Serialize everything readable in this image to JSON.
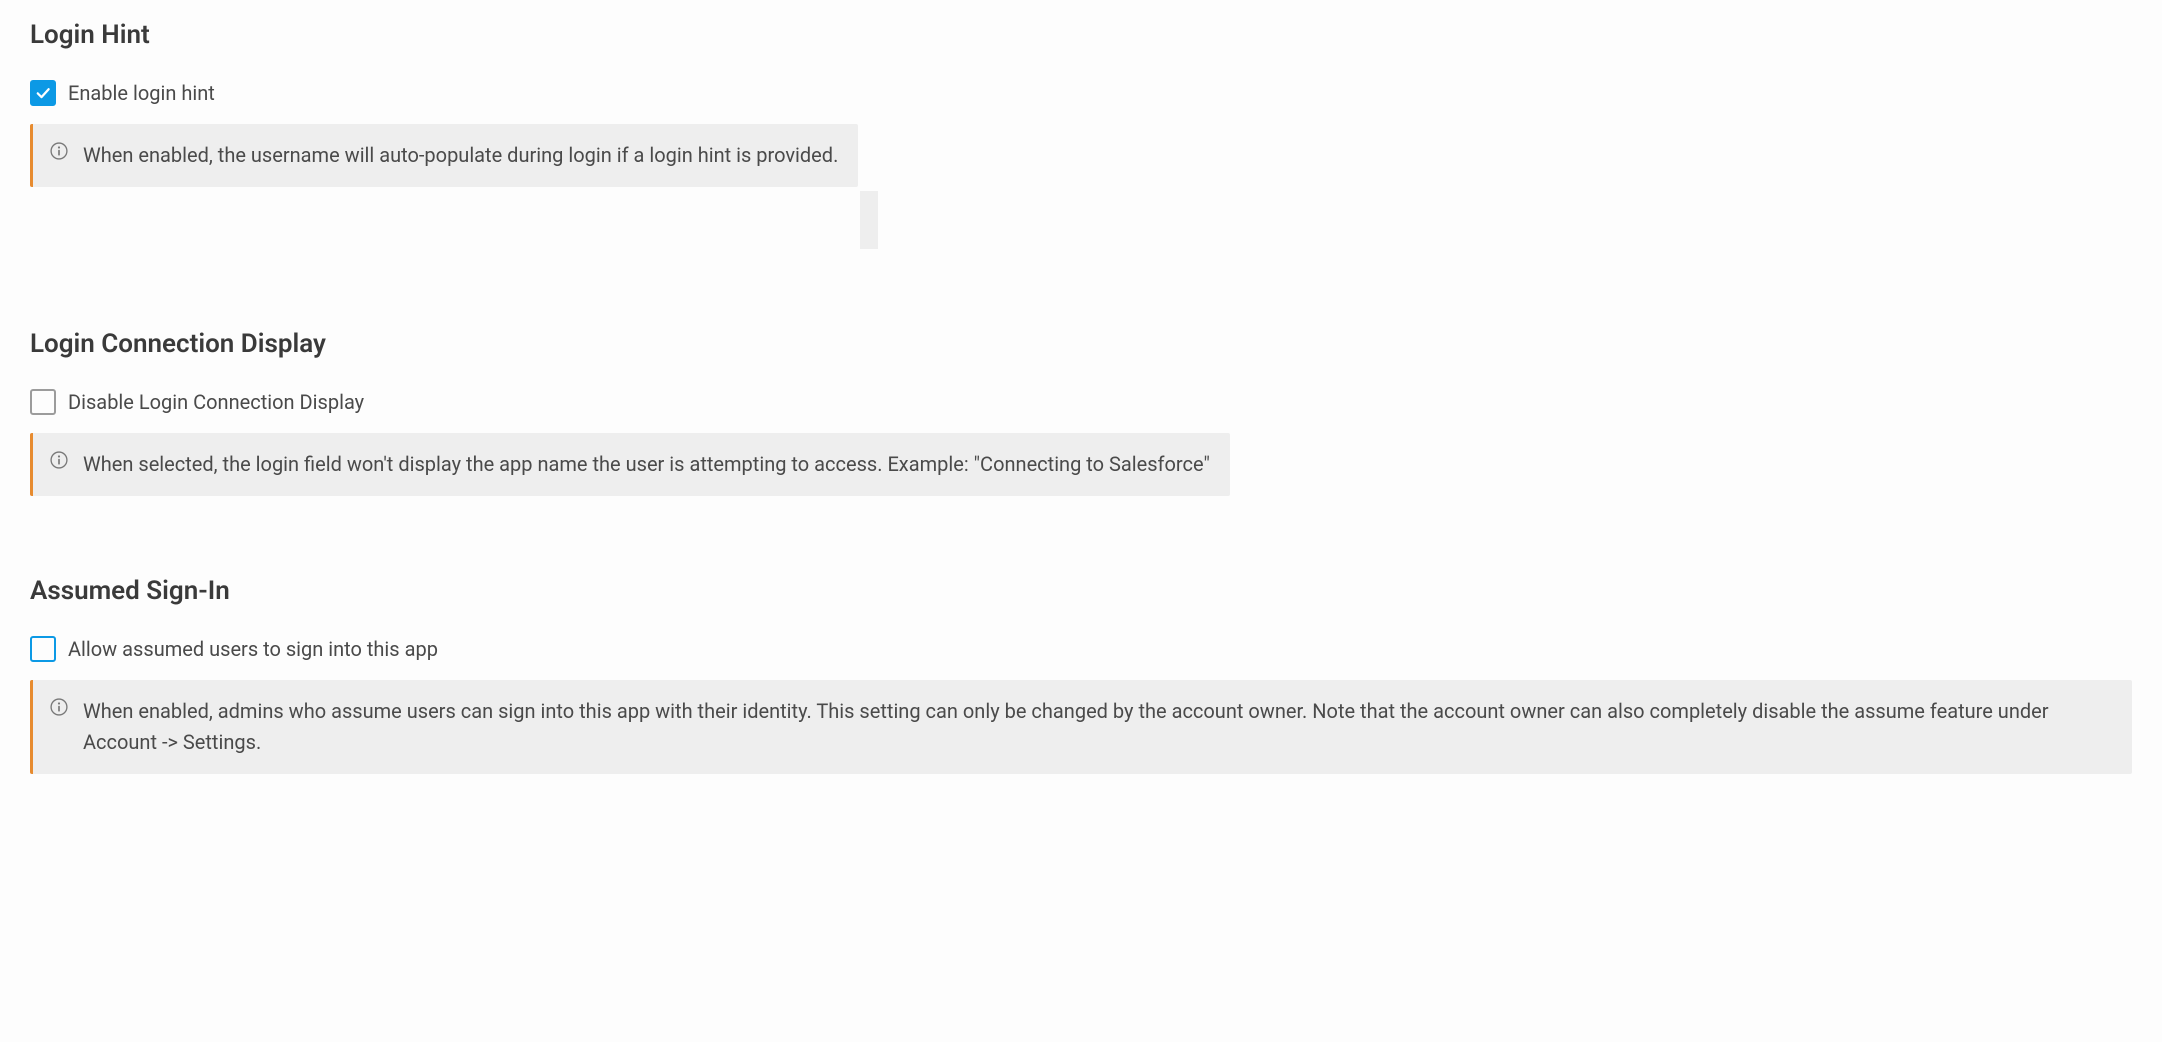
{
  "sections": {
    "login_hint": {
      "heading": "Login Hint",
      "checkbox_label": "Enable login hint",
      "checkbox_checked": true,
      "info": "When enabled, the username will auto-populate during login if a login hint is provided."
    },
    "login_connection": {
      "heading": "Login Connection Display",
      "checkbox_label": "Disable Login Connection Display",
      "checkbox_checked": false,
      "info": "When selected, the login field won't display the app name the user is attempting to access. Example: \"Connecting to Salesforce\""
    },
    "assumed_signin": {
      "heading": "Assumed Sign-In",
      "checkbox_label": "Allow assumed users to sign into this app",
      "checkbox_checked": false,
      "info": "When enabled, admins who assume users can sign into this app with their identity. This setting can only be changed by the account owner. Note that the account owner can also completely disable the assume feature under Account -> Settings."
    }
  }
}
